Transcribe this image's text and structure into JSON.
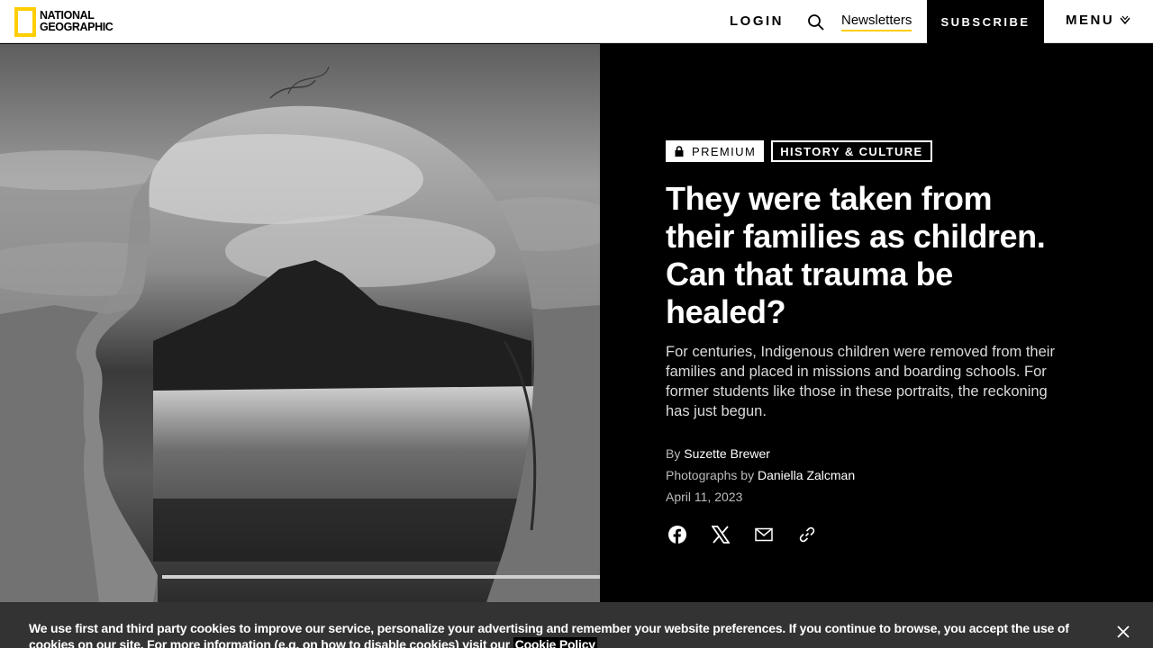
{
  "header": {
    "logo_line1": "National",
    "logo_line2": "Geographic",
    "login_label": "LOGIN",
    "newsletters_label": "Newsletters",
    "subscribe_label": "SUBSCRIBE",
    "menu_label": "MENU"
  },
  "article": {
    "premium_label": "PREMIUM",
    "category_label": "HISTORY & CULTURE",
    "headline": "They were taken from their families as children. Can that trauma be healed?",
    "dek": "For centuries, Indigenous children were removed from their families and placed in missions and boarding schools. For former students like those in these portraits, the reckoning has just begun.",
    "by_prefix": "By",
    "author": "Suzette Brewer",
    "photos_prefix": "Photographs by",
    "photographer": "Daniella Zalcman",
    "date": "April 11, 2023"
  },
  "share": {
    "icons": [
      "facebook-icon",
      "x-icon",
      "email-icon",
      "link-icon"
    ]
  },
  "cookie": {
    "text": "We use first and third party cookies to improve our service, personalize your advertising and remember your website preferences. If you continue to browse, you accept the use of cookies on our site. For more information (e.g. on how to disable cookies) visit our",
    "link_label": "Cookie Policy"
  },
  "colors": {
    "brand_yellow": "#FFCE00",
    "background": "#000000",
    "cookie_bar": "#333333"
  }
}
